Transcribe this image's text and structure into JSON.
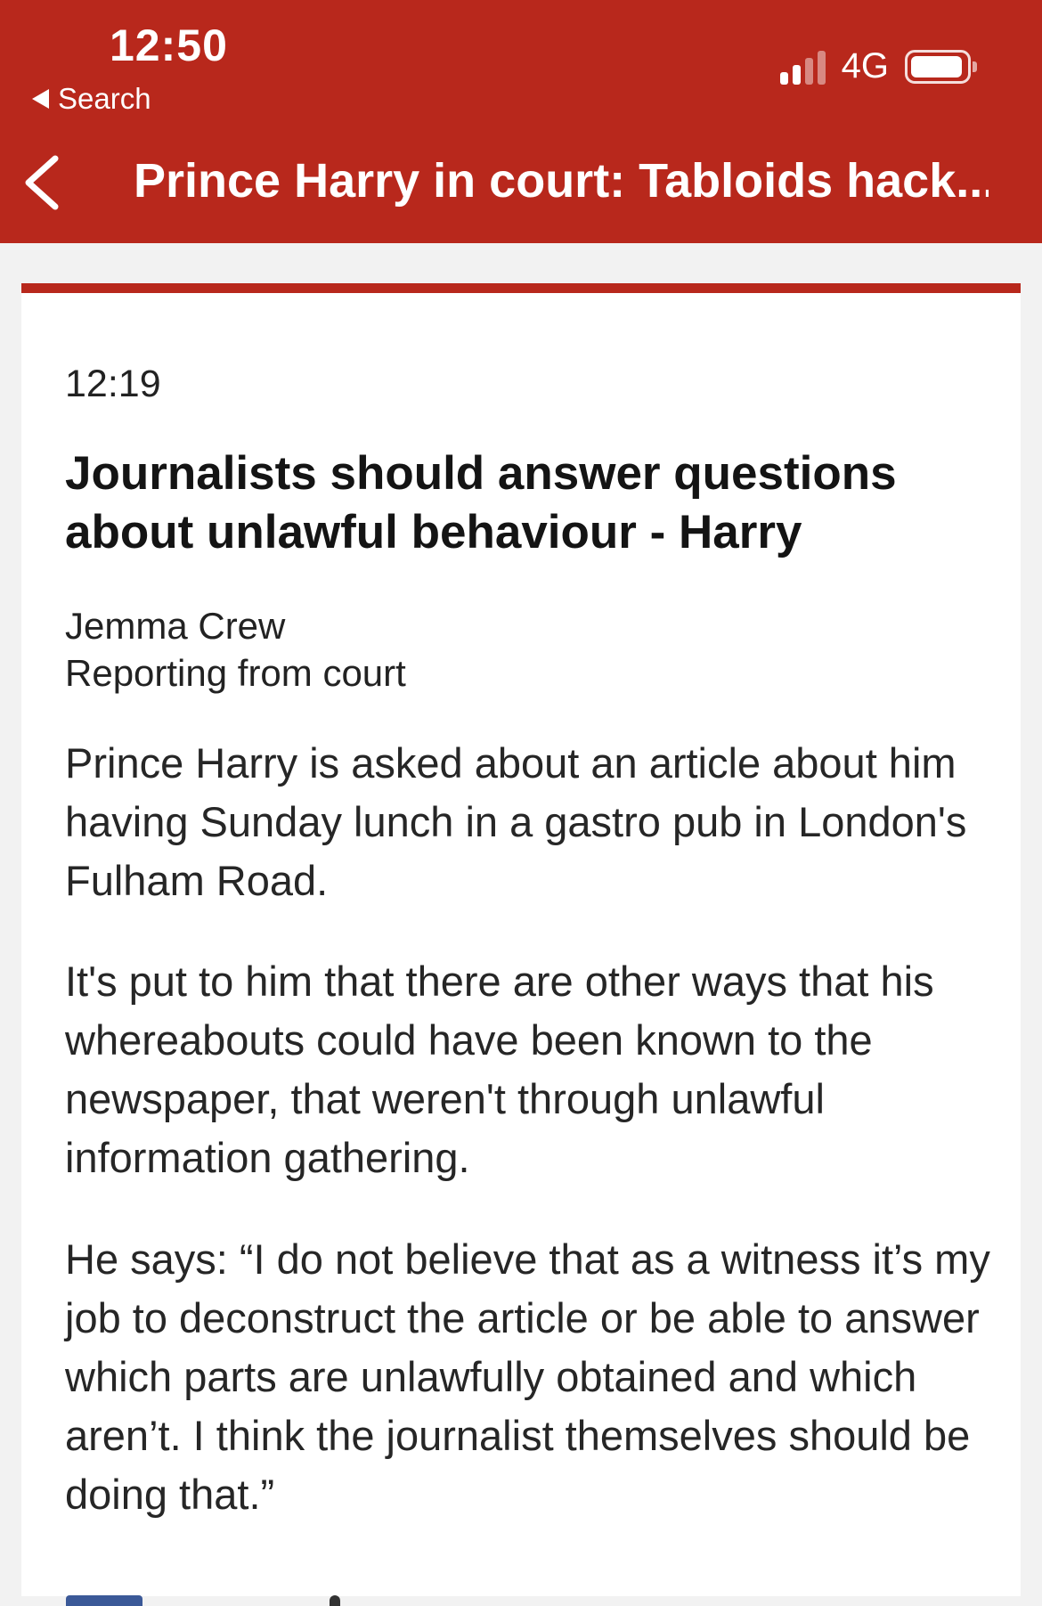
{
  "status_bar": {
    "time": "12:50",
    "back_app": "Search",
    "network": "4G",
    "signal_bars": 2,
    "battery_level": 0.95
  },
  "nav": {
    "title": "Prince Harry in court: Tabloids hack..."
  },
  "post": {
    "timestamp": "12:19",
    "headline": "Journalists should answer questions about unlawful behaviour - Harry",
    "author": "Jemma Crew",
    "author_role": "Reporting from court",
    "paragraphs": [
      "Prince Harry is asked about an article about him having Sunday lunch in a gastro pub in London's Fulham Road.",
      "It's put to him that there are other ways that his whereabouts could have been known to the newspaper, that weren't through unlawful information gathering.",
      "He says: “I do not believe that as a witness it’s my job to deconstruct the article or be able to answer which parts are unlawfully obtained and which aren’t. I think the journalist themselves should be doing that.”"
    ]
  },
  "colors": {
    "brand_red": "#b8281c",
    "background": "#f2f2f2",
    "card": "#ffffff"
  },
  "icons": {
    "back": "chevron-left-icon",
    "status_back": "triangle-left-icon",
    "signal": "signal-icon",
    "battery": "battery-icon"
  }
}
